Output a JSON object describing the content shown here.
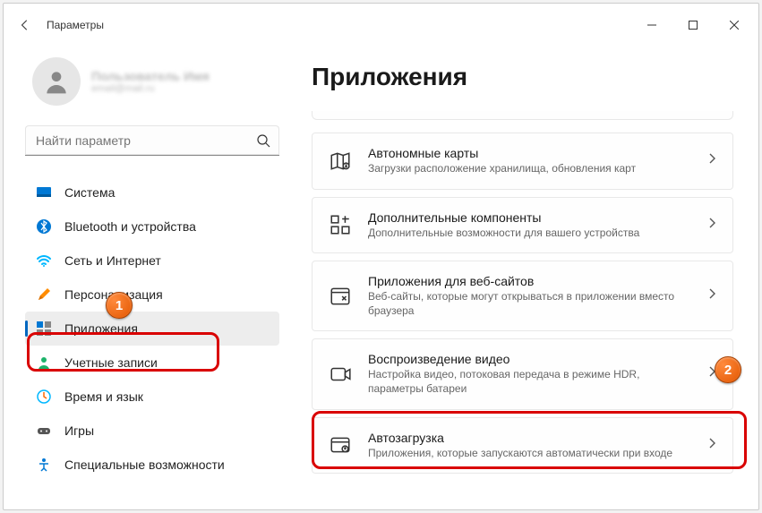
{
  "window": {
    "title": "Параметры"
  },
  "profile": {
    "name": "Пользователь Имя",
    "email": "email@mail.ru"
  },
  "search": {
    "placeholder": "Найти параметр"
  },
  "sidebar": {
    "items": [
      {
        "label": "Система"
      },
      {
        "label": "Bluetooth и устройства"
      },
      {
        "label": "Сеть и Интернет"
      },
      {
        "label": "Персонализация"
      },
      {
        "label": "Приложения"
      },
      {
        "label": "Учетные записи"
      },
      {
        "label": "Время и язык"
      },
      {
        "label": "Игры"
      },
      {
        "label": "Специальные возможности"
      }
    ]
  },
  "page": {
    "title": "Приложения"
  },
  "cards": [
    {
      "title": "Автономные карты",
      "sub": "Загрузки расположение хранилища, обновления карт"
    },
    {
      "title": "Дополнительные компоненты",
      "sub": "Дополнительные возможности для вашего устройства"
    },
    {
      "title": "Приложения для веб-сайтов",
      "sub": "Веб-сайты, которые могут открываться в приложении вместо браузера"
    },
    {
      "title": "Воспроизведение видео",
      "sub": "Настройка видео, потоковая передача в режиме HDR, параметры батареи"
    },
    {
      "title": "Автозагрузка",
      "sub": "Приложения, которые запускаются автоматически при входе"
    }
  ],
  "annotations": {
    "badge1": "1",
    "badge2": "2"
  }
}
